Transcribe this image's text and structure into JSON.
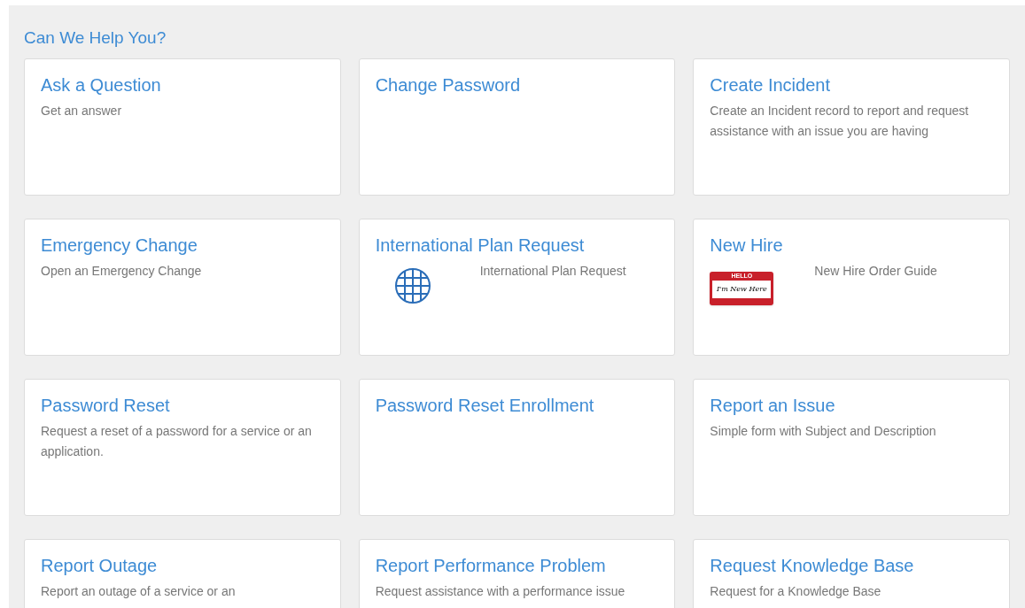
{
  "section": {
    "title": "Can We Help You?"
  },
  "items": [
    {
      "title": "Ask a Question",
      "description": "Get an answer"
    },
    {
      "title": "Change Password"
    },
    {
      "title": "Create Incident",
      "description": "Create an Incident record to report and request assistance with an issue you are having"
    },
    {
      "title": "Emergency Change",
      "description": "Open an Emergency Change"
    },
    {
      "title": "International Plan Request",
      "description": "International Plan Request",
      "image": {
        "kind": "globe"
      }
    },
    {
      "title": "New Hire",
      "description": "New Hire Order Guide",
      "image": {
        "kind": "name_tag",
        "header": "HELLO",
        "text": "I'm New Here"
      }
    },
    {
      "title": "Password Reset",
      "description": "Request a reset of a password for a service or an application."
    },
    {
      "title": "Password Reset Enrollment"
    },
    {
      "title": "Report an Issue",
      "description": "Simple form with Subject and Description"
    },
    {
      "title": "Report Outage",
      "description": "Report an outage of a service or an"
    },
    {
      "title": "Report Performance Problem",
      "description": "Request assistance with a performance issue"
    },
    {
      "title": "Request Knowledge Base",
      "description": "Request for a Knowledge Base"
    }
  ]
}
